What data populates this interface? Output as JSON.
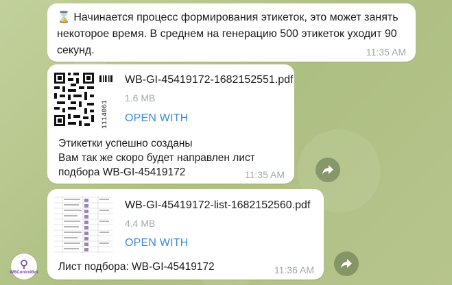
{
  "messages": [
    {
      "text": "Начинается процесс формирования этикеток, это может занять некоторое время. В среднем на генерацию 500 этикеток уходит 90 секунд.",
      "time": "11:35 AM",
      "icon": "hourglass-icon"
    },
    {
      "file": {
        "name": "WB-GI-45419172-1682152551.pdf",
        "size": "1.6 MB",
        "open_label": "OPEN WITH",
        "thumb_barcode_text": "1114061"
      },
      "text_lines": [
        "Этикетки успешно созданы",
        "Вам так же скоро будет направлен лист",
        "подбора WB-GI-45419172"
      ],
      "time": "11:35 AM"
    },
    {
      "file": {
        "name": "WB-GI-45419172-list-1682152560.pdf",
        "size": "4.4 MB",
        "open_label": "OPEN WITH"
      },
      "text": "Лист подбора: WB-GI-45419172",
      "time": "11:36 AM"
    }
  ],
  "bot": {
    "avatar_label": "WBControlBot"
  },
  "colors": {
    "accent": "#3a8bd6",
    "timestamp": "#a0a8ad",
    "bubble": "#ffffff",
    "wallpaper": "#b9c98f"
  }
}
